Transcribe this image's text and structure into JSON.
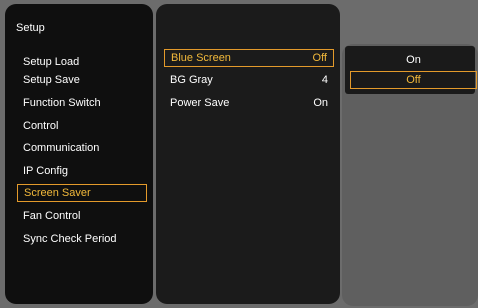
{
  "setup_menu": {
    "title": "Setup",
    "items": [
      {
        "label": "Setup Load"
      },
      {
        "label": "Setup Save"
      },
      {
        "label": "Function Switch"
      },
      {
        "label": "Control"
      },
      {
        "label": "Communication"
      },
      {
        "label": "IP Config"
      },
      {
        "label": "Screen Saver"
      },
      {
        "label": "Fan Control"
      },
      {
        "label": "Sync Check Period"
      }
    ],
    "selected_index": 6
  },
  "screen_saver_menu": {
    "items": [
      {
        "label": "Blue Screen",
        "value": "Off"
      },
      {
        "label": "BG Gray",
        "value": "4"
      },
      {
        "label": "Power Save",
        "value": "On"
      }
    ],
    "selected_index": 0
  },
  "option_menu": {
    "options": [
      {
        "label": "On"
      },
      {
        "label": "Off"
      }
    ],
    "selected_index": 1
  },
  "colors": {
    "highlight_border": "#e39a2b",
    "highlight_text": "#f2b93b",
    "panel_background": "#0f0f0f",
    "screen_background": "#6c6c6c"
  }
}
